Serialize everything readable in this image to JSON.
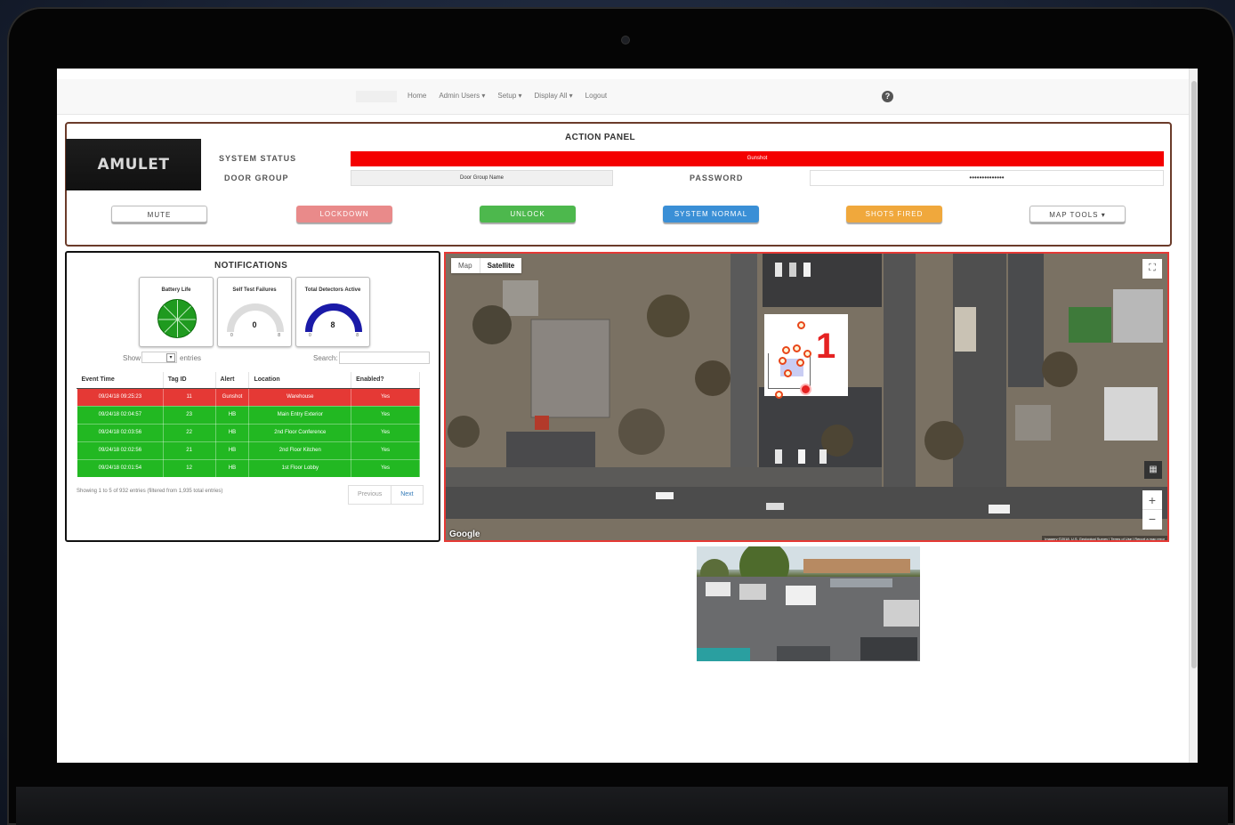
{
  "nav": {
    "items": [
      "Home",
      "Admin Users ▾",
      "Setup ▾",
      "Display All ▾",
      "Logout"
    ],
    "help_icon": "question-circle-icon"
  },
  "action_panel": {
    "title": "ACTION PANEL",
    "logo_text": "AMULET",
    "system_status_label": "SYSTEM STATUS",
    "system_status_value": "Gunshot",
    "system_status_color": "#f40000",
    "door_group_label": "DOOR GROUP",
    "door_group_value": "Door Group Name",
    "password_label": "PASSWORD",
    "password_value": "••••••••••••••",
    "buttons": {
      "mute": "MUTE",
      "lockdown": "LOCKDOWN",
      "unlock": "UNLOCK",
      "system_normal": "SYSTEM NORMAL",
      "shots_fired": "SHOTS FIRED",
      "map_tools": "MAP TOOLS ▾"
    },
    "button_colors": {
      "lockdown": "#e98a8a",
      "unlock": "#4db84d",
      "system_normal": "#3a8fd6",
      "shots_fired": "#f0a83c"
    }
  },
  "notifications": {
    "title": "NOTIFICATIONS",
    "gauges": [
      {
        "label": "Battery Life",
        "type": "pie"
      },
      {
        "label": "Self Test Failures",
        "value": "0",
        "min": "0",
        "max": "8",
        "fraction": 0.0
      },
      {
        "label": "Total Detectors Active",
        "value": "8",
        "min": "0",
        "max": "8",
        "fraction": 1.0
      }
    ],
    "show_label": "Show",
    "entries_label": "entries",
    "search_label": "Search:",
    "columns": [
      "Event Time",
      "Tag ID",
      "Alert",
      "Location",
      "Enabled?"
    ],
    "rows": [
      {
        "event_time": "09/24/18 09:25:23",
        "tag_id": "11",
        "alert": "Gunshot",
        "location": "Warehouse",
        "enabled": "Yes",
        "status": "alarm"
      },
      {
        "event_time": "09/24/18 02:04:57",
        "tag_id": "23",
        "alert": "HB",
        "location": "Main Entry Exterior",
        "enabled": "Yes",
        "status": "ok"
      },
      {
        "event_time": "09/24/18 02:03:56",
        "tag_id": "22",
        "alert": "HB",
        "location": "2nd Floor Conference",
        "enabled": "Yes",
        "status": "ok"
      },
      {
        "event_time": "09/24/18 02:02:56",
        "tag_id": "21",
        "alert": "HB",
        "location": "2nd Floor Kitchen",
        "enabled": "Yes",
        "status": "ok"
      },
      {
        "event_time": "09/24/18 02:01:54",
        "tag_id": "12",
        "alert": "HB",
        "location": "1st Floor Lobby",
        "enabled": "Yes",
        "status": "ok"
      }
    ],
    "info": "Showing 1 to 5 of 932 entries (filtered from 1,935 total entries)",
    "prev_label": "Previous",
    "next_label": "Next"
  },
  "map": {
    "tab_map": "Map",
    "tab_satellite": "Satellite",
    "active_tab": "Satellite",
    "floor_number": "1",
    "google_label": "Google",
    "credits": "Imagery ©2018, U.S. Geological Survey | Terms of Use | Report a map error",
    "zoom_in": "+",
    "zoom_out": "−"
  },
  "camera": {
    "icon": "camera-feed-image"
  }
}
